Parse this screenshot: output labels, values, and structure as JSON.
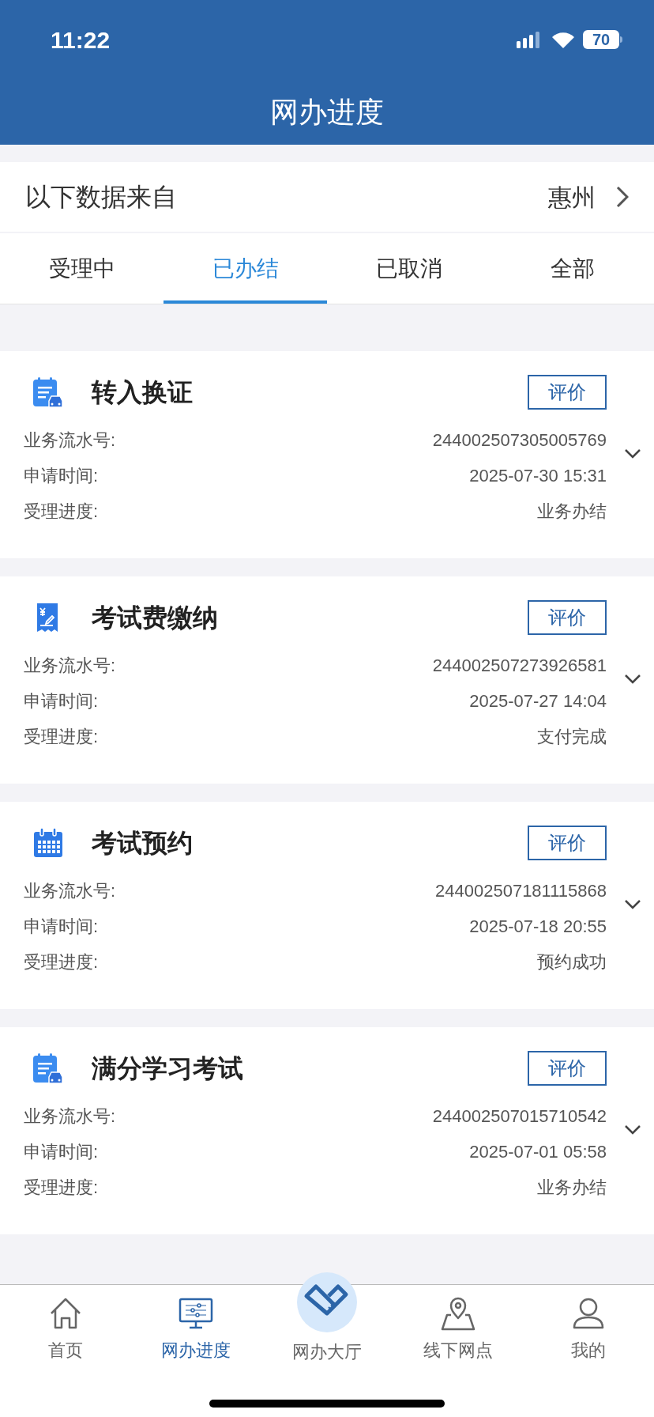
{
  "status_bar": {
    "time": "11:22",
    "battery": "70"
  },
  "header": {
    "title": "网办进度"
  },
  "source": {
    "label": "以下数据来自",
    "city": "惠州"
  },
  "tabs": [
    {
      "label": "受理中",
      "selected": false
    },
    {
      "label": "已办结",
      "selected": true
    },
    {
      "label": "已取消",
      "selected": false
    },
    {
      "label": "全部",
      "selected": false
    }
  ],
  "records": [
    {
      "kind": "notepad-car",
      "title": "转入换证",
      "button": "评价",
      "fields": [
        {
          "label": "业务流水号:",
          "value": "244002507305005769"
        },
        {
          "label": "申请时间:",
          "value": "2025-07-30 15:31"
        },
        {
          "label": "受理进度:",
          "value": "业务办结"
        }
      ]
    },
    {
      "kind": "receipt",
      "title": "考试费缴纳",
      "button": "评价",
      "fields": [
        {
          "label": "业务流水号:",
          "value": "244002507273926581"
        },
        {
          "label": "申请时间:",
          "value": "2025-07-27 14:04"
        },
        {
          "label": "受理进度:",
          "value": "支付完成"
        }
      ]
    },
    {
      "kind": "calendar",
      "title": "考试预约",
      "button": "评价",
      "fields": [
        {
          "label": "业务流水号:",
          "value": "244002507181115868"
        },
        {
          "label": "申请时间:",
          "value": "2025-07-18 20:55"
        },
        {
          "label": "受理进度:",
          "value": "预约成功"
        }
      ]
    },
    {
      "kind": "notepad-car",
      "title": "满分学习考试",
      "button": "评价",
      "fields": [
        {
          "label": "业务流水号:",
          "value": "244002507015710542"
        },
        {
          "label": "申请时间:",
          "value": "2025-07-01 05:58"
        },
        {
          "label": "受理进度:",
          "value": "业务办结"
        }
      ]
    }
  ],
  "nav": [
    {
      "kind": "home",
      "label": "首页",
      "selected": false
    },
    {
      "kind": "monitor",
      "label": "网办进度",
      "selected": true
    },
    {
      "kind": "hall",
      "label": "网办大厅",
      "selected": false
    },
    {
      "kind": "map",
      "label": "线下网点",
      "selected": false
    },
    {
      "kind": "user",
      "label": "我的",
      "selected": false
    }
  ]
}
